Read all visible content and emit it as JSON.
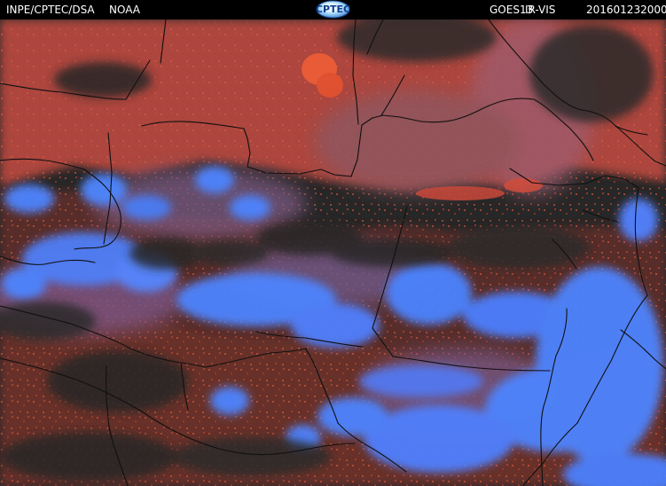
{
  "header": {
    "source": "INPE/CPTEC/DSA",
    "agency": "NOAA",
    "logo": "CPTEC",
    "satellite": "GOES13",
    "product": "IR-VIS",
    "timestamp": "201601232000"
  },
  "palette": {
    "background": "#272727",
    "cloud_red": "#d54a34",
    "cloud_magenta": "#8f5a8e",
    "cloud_blue": "#4d84ff",
    "border": "#101010",
    "text": "#ffffff",
    "header": "#000000"
  }
}
